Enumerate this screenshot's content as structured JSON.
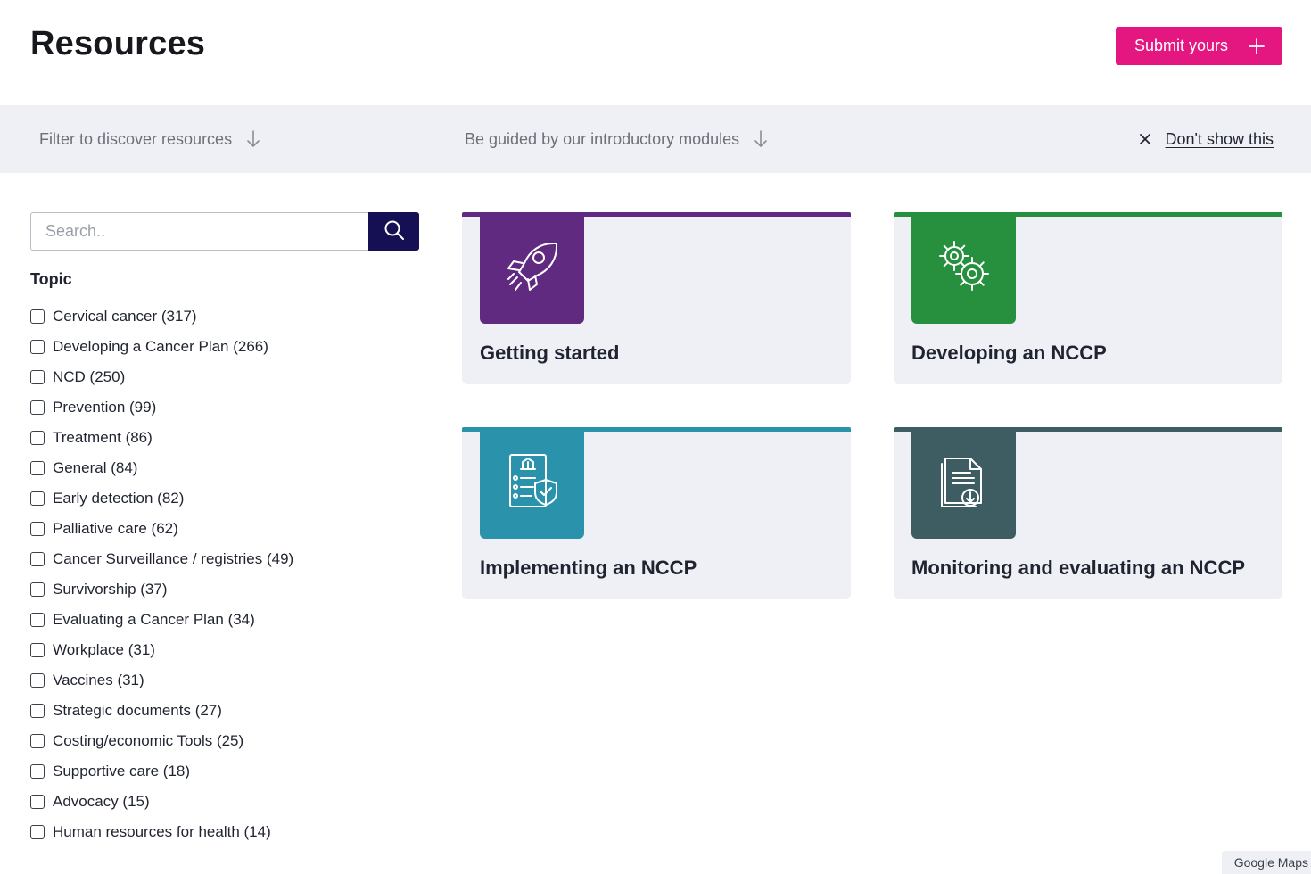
{
  "header": {
    "title": "Resources",
    "submit_label": "Submit yours"
  },
  "guide_bar": {
    "filter_label": "Filter to discover resources",
    "modules_label": "Be guided by our introductory modules",
    "dismiss_label": "Don't show this"
  },
  "search": {
    "placeholder": "Search..",
    "value": ""
  },
  "topic": {
    "heading": "Topic",
    "items": [
      {
        "label": "Cervical cancer (317)",
        "checked": false
      },
      {
        "label": "Developing a Cancer Plan (266)",
        "checked": false
      },
      {
        "label": "NCD (250)",
        "checked": false
      },
      {
        "label": "Prevention (99)",
        "checked": false
      },
      {
        "label": "Treatment (86)",
        "checked": false
      },
      {
        "label": "General (84)",
        "checked": false
      },
      {
        "label": "Early detection (82)",
        "checked": false
      },
      {
        "label": "Palliative care (62)",
        "checked": false
      },
      {
        "label": "Cancer Surveillance / registries (49)",
        "checked": false
      },
      {
        "label": "Survivorship (37)",
        "checked": false
      },
      {
        "label": "Evaluating a Cancer Plan (34)",
        "checked": false
      },
      {
        "label": "Workplace (31)",
        "checked": false
      },
      {
        "label": "Vaccines (31)",
        "checked": false
      },
      {
        "label": "Strategic documents (27)",
        "checked": false
      },
      {
        "label": "Costing/economic Tools (25)",
        "checked": false
      },
      {
        "label": "Supportive care (18)",
        "checked": false
      },
      {
        "label": "Advocacy (15)",
        "checked": false
      },
      {
        "label": "Human resources for health (14)",
        "checked": false
      }
    ]
  },
  "modules": [
    {
      "title": "Getting started",
      "icon": "rocket-icon",
      "color": "#5f2a80"
    },
    {
      "title": "Developing an NCCP",
      "icon": "gears-icon",
      "color": "#27903f"
    },
    {
      "title": "Implementing an NCCP",
      "icon": "checklist-shield-icon",
      "color": "#2a93ab"
    },
    {
      "title": "Monitoring and evaluating an NCCP",
      "icon": "document-download-icon",
      "color": "#3e5d62"
    }
  ],
  "colors": {
    "accent": "#e3177f",
    "search_button": "#150f54",
    "panel_bg": "#eef0f5"
  },
  "attribution": "Google Maps"
}
